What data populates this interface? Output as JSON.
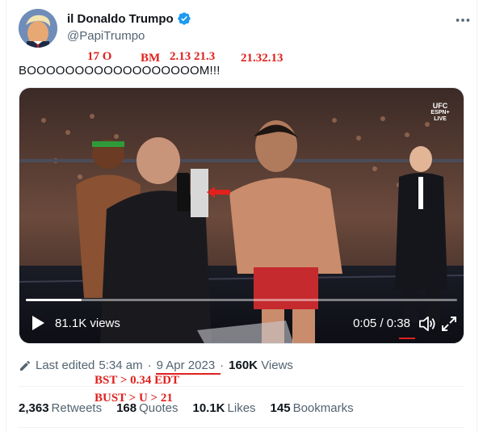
{
  "tweet": {
    "display_name": "il Donaldo Trumpo",
    "handle": "@PapiTrumpo",
    "text": "BOOOOOOOOOOOOOOOOOOM!!!"
  },
  "annotations": {
    "a1": "17 O",
    "a2": "BM",
    "a3": "2.13 21.3",
    "a4": "21.32.13",
    "a5": "BST >  0.34 EDT",
    "a6": "BUST > U > 21"
  },
  "video": {
    "views_label": "81.1K views",
    "time_elapsed": "0:05",
    "time_separator": " / ",
    "time_total": "0:38",
    "progress": 0.13,
    "overlay_brand": "UFC",
    "overlay_network": "ESPN+",
    "overlay_status": "LIVE"
  },
  "meta": {
    "edited_prefix": "Last edited",
    "time": "5:34 am",
    "separator": "·",
    "date": "9 Apr 2023",
    "views_count": "160K",
    "views_label": "Views"
  },
  "stats": {
    "retweets_count": "2,363",
    "retweets_label": "Retweets",
    "quotes_count": "168",
    "quotes_label": "Quotes",
    "likes_count": "10.1K",
    "likes_label": "Likes",
    "bookmarks_count": "145",
    "bookmarks_label": "Bookmarks"
  },
  "colors": {
    "verified_blue": "#1d9bf0",
    "annotation_red": "#e0211d",
    "text_primary": "#0f1419",
    "text_secondary": "#536471"
  },
  "icons": [
    "verified-badge-icon",
    "more-icon",
    "play-icon",
    "volume-icon",
    "fullscreen-icon",
    "pencil-icon",
    "red-arrow-icon"
  ]
}
